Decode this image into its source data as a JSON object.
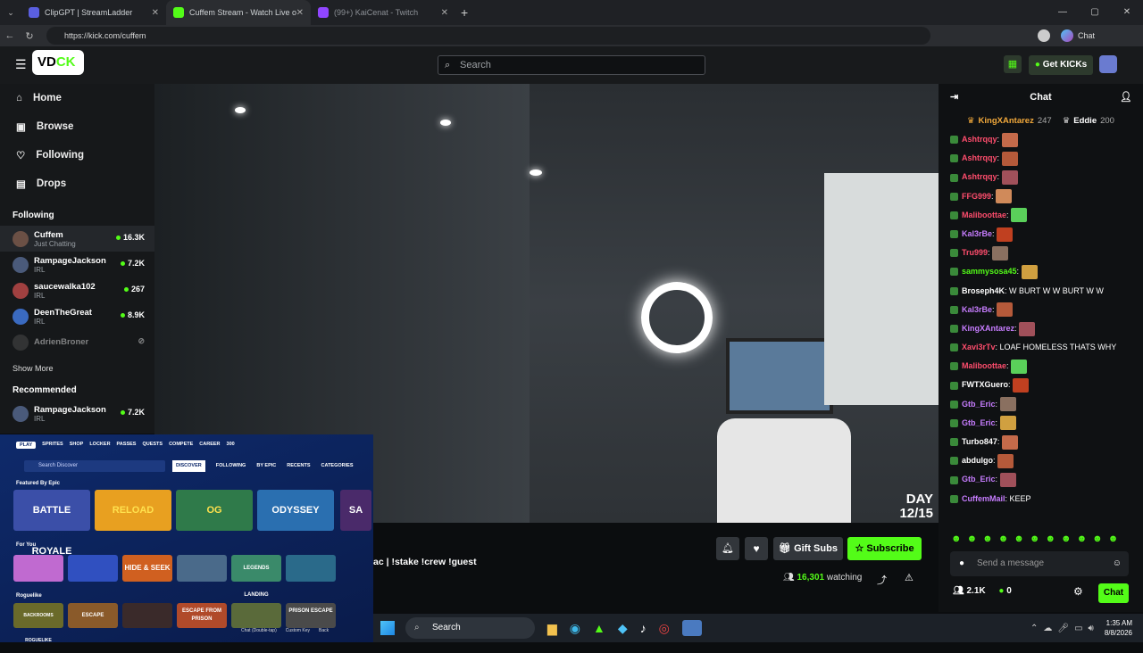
{
  "browser": {
    "tabs": [
      {
        "title": "ClipGPT | StreamLadder",
        "color": "#5a5fe0"
      },
      {
        "title": "Cuffem Stream - Watch Live o",
        "color": "#53fc18",
        "active": true
      },
      {
        "title": "(99+) KaiCenat - Twitch",
        "color": "#9146ff"
      }
    ],
    "url": "https://kick.com/cuffem",
    "chat_btn": "Chat"
  },
  "kick": {
    "search_placeholder": "Search",
    "get_kicks": "Get KICKs",
    "nav": [
      {
        "label": "Home",
        "icon": "home-icon"
      },
      {
        "label": "Browse",
        "icon": "browse-icon"
      },
      {
        "label": "Following",
        "icon": "heart-icon"
      },
      {
        "label": "Drops",
        "icon": "drops-icon"
      }
    ],
    "following_title": "Following",
    "following": [
      {
        "name": "Cuffem",
        "category": "Just Chatting",
        "count": "16.3K"
      },
      {
        "name": "RampageJackson",
        "category": "IRL",
        "count": "7.2K"
      },
      {
        "name": "saucewalka102",
        "category": "IRL",
        "count": "267"
      },
      {
        "name": "DeenTheGreat",
        "category": "IRL",
        "count": "8.9K"
      },
      {
        "name": "AdrienBroner",
        "category": "",
        "count": ""
      }
    ],
    "show_more": "Show More",
    "recommended_title": "Recommended",
    "recommended": [
      {
        "name": "RampageJackson",
        "category": "IRL",
        "count": "7.2K"
      }
    ],
    "stream_title_fragment": "ac | !stake !crew !guest",
    "day_overlay": "DAY 12/15",
    "gift_subs": "Gift Subs",
    "subscribe": "Subscribe",
    "watching": "16,301",
    "watching_label": "watching",
    "chat": {
      "title": "Chat",
      "gifters": [
        {
          "name": "KingXAntarez",
          "count": "247",
          "color": "#f2a93b"
        },
        {
          "name": "Eddie",
          "count": "200",
          "color": "#c0c0c0"
        }
      ],
      "messages": [
        {
          "user": "Ashtrqqy",
          "color": "#ff4d6d",
          "text": ""
        },
        {
          "user": "Ashtrqqy",
          "color": "#ff4d6d",
          "text": ""
        },
        {
          "user": "Ashtrqqy",
          "color": "#ff4d6d",
          "text": ""
        },
        {
          "user": "FFG999",
          "color": "#ff4d6d",
          "text": ""
        },
        {
          "user": "Maliboottae",
          "color": "#ff4d6d",
          "text": ""
        },
        {
          "user": "Kal3rBe",
          "color": "#c77dff",
          "text": ""
        },
        {
          "user": "Tru999",
          "color": "#ff4d6d",
          "text": ""
        },
        {
          "user": "sammysosa45",
          "color": "#53fc18",
          "text": ""
        },
        {
          "user": "Broseph4K",
          "color": "#ffffff",
          "text": "W BURT  W W BURT  W W"
        },
        {
          "user": "Kal3rBe",
          "color": "#c77dff",
          "text": ""
        },
        {
          "user": "KingXAntarez",
          "color": "#c77dff",
          "text": ""
        },
        {
          "user": "Xavi3rTv",
          "color": "#ff4d6d",
          "text": "LOAF HOMELESS THATS WHY"
        },
        {
          "user": "Maliboottae",
          "color": "#ff4d6d",
          "text": ""
        },
        {
          "user": "FWTXGuero",
          "color": "#ffffff",
          "text": ""
        },
        {
          "user": "Gtb_Eric",
          "color": "#c77dff",
          "text": ""
        },
        {
          "user": "Gtb_Eric",
          "color": "#c77dff",
          "text": ""
        },
        {
          "user": "Turbo847",
          "color": "#ffffff",
          "text": ""
        },
        {
          "user": "abdulgo",
          "color": "#ffffff",
          "text": ""
        },
        {
          "user": "Gtb_Eric",
          "color": "#c77dff",
          "text": ""
        },
        {
          "user": "CuffemMail",
          "color": "#c77dff",
          "text": "KEEP"
        }
      ],
      "input_placeholder": "Send a message",
      "viewers_count": "2.1K",
      "kicks_count": "0",
      "send_btn": "Chat"
    }
  },
  "fortnite": {
    "tabs": [
      "PLAY",
      "SPRITES",
      "SHOP",
      "LOCKER",
      "PASSES",
      "QUESTS",
      "COMPETE",
      "CAREER",
      "300"
    ],
    "search_placeholder": "Search Discover",
    "subtabs": [
      "DISCOVER",
      "FOLLOWING",
      "BY EPIC",
      "RECENTS",
      "CATEGORIES"
    ],
    "featured_title": "Featured By Epic",
    "featured": [
      "BATTLE ROYALE",
      "RELOAD",
      "OG",
      "ODYSSEY",
      "SA"
    ],
    "foryou_title": "For You",
    "foryou": [
      "",
      "",
      "HIDE & SEEK",
      "",
      "LEGENDS LANDING",
      ""
    ],
    "roguelike_title": "Roguelike",
    "roguelike": [
      "BACKROOMS ROGUELIKE",
      "ESCAPE",
      "",
      "ESCAPE FROM PRISON",
      "",
      "PRISON ESCAPE"
    ],
    "footer": [
      "Chat (Double-tap)",
      "Custom Key",
      "Back"
    ]
  },
  "taskbar": {
    "search": "Search",
    "time": "1:35 AM",
    "date": "8/8/2026"
  }
}
